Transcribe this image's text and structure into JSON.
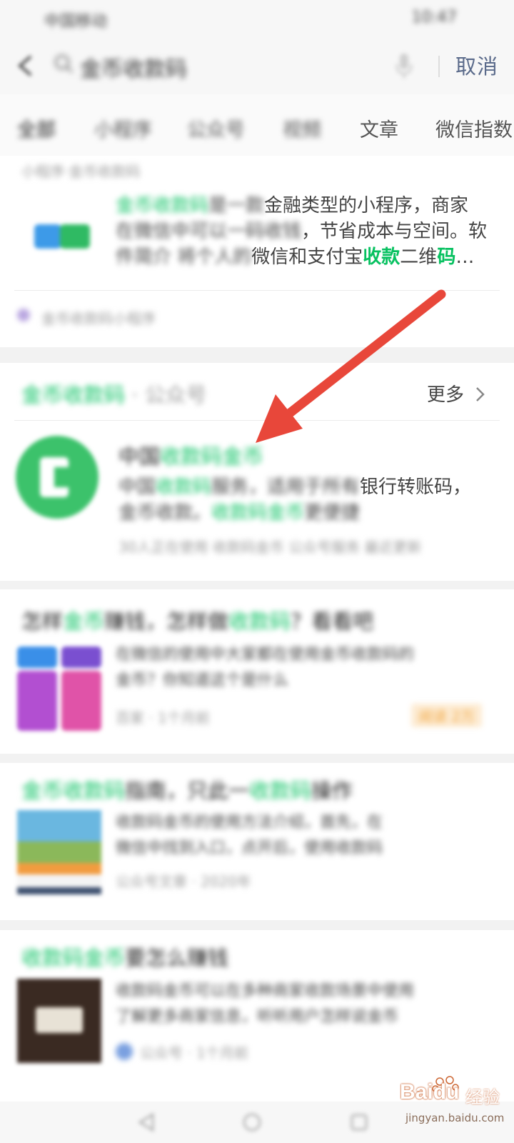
{
  "status_bar": {
    "left": "中国移动",
    "right": "10:47"
  },
  "search": {
    "query": "金币收款码",
    "cancel_label": "取消"
  },
  "tabs": [
    {
      "label": "全部"
    },
    {
      "label": "小程序"
    },
    {
      "label": "公众号"
    },
    {
      "label": "视频"
    },
    {
      "label": "文章"
    },
    {
      "label": "微信指数"
    }
  ],
  "card1": {
    "top_line": "小程序·金币收款码",
    "desc_line1_a": "金币收款码",
    "desc_line1_b": "是一款",
    "desc_line1_c": "金融类型的小程序，商家",
    "desc_line2_a": "在微信中可以一码收钱",
    "desc_line2_b": "节省成本与空间。软",
    "desc_line3_a": "件简介  将个人的",
    "desc_line3_b": "微信和支付宝",
    "desc_line3_c": "收款",
    "desc_line3_d": "二维",
    "desc_line3_e": "码",
    "desc_line3_f": "…",
    "footer": "金币收款码小程序"
  },
  "card2": {
    "header_green": "金币收款码",
    "header_rest": " · 公众号",
    "more_label": "更多",
    "account_prefix": "中国",
    "account_green": "收款码金币",
    "desc_line1_a": "中国",
    "desc_line1_b": "收款码",
    "desc_line1_c": "服务，适用于所有",
    "desc_line1_d": "银行转账码，",
    "desc_line2_a": "金币收款。",
    "desc_line2_b": "收款码金币",
    "desc_line2_c": "更便捷",
    "footer": "30人正在使用 收款码金币 公众号服务 最近更新"
  },
  "card3": {
    "title_a": "怎样",
    "title_b": "金币",
    "title_c": "赚钱，怎样做",
    "title_d": "收款码",
    "title_e": "？看看吧",
    "desc_line1": "在微信的使用中大家都在使用金币收款码的",
    "desc_line2": "金币？你知道这个是什么",
    "meta": "百家 · 1个月前",
    "badge": "阅读 2万"
  },
  "card4": {
    "title_a": "金币收款码",
    "title_b": "指南，只此一",
    "title_c": "收款码",
    "title_d": "操作",
    "desc_line1": "收款码金币的使用方法介绍，首先，在",
    "desc_line2": "微信中找到入口，点开后，使用收款码",
    "meta": "公众号文章 · 2020年"
  },
  "card5": {
    "title_a": "收款码金币",
    "title_b": "要怎么赚钱",
    "desc_line1": "收款码金币可以在多种商家收款场景中使用",
    "desc_line2": "了解更多商家信息，听听用户怎样说金币",
    "meta": "公众号 · 1个月前"
  },
  "watermark": {
    "brand": "Bai",
    "brand2": "du",
    "cn": "经验",
    "url": "jingyan.baidu.com"
  },
  "colors": {
    "green": "#07c160",
    "arrow": "#e8473a",
    "cancel": "#5b6b8b"
  }
}
